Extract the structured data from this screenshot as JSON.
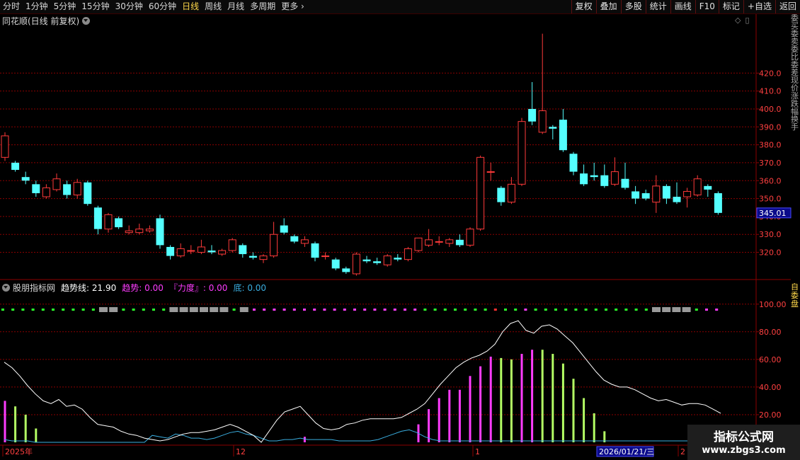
{
  "toolbar": {
    "periods": [
      "分时",
      "1分钟",
      "5分钟",
      "15分钟",
      "30分钟",
      "60分钟",
      "日线",
      "周线",
      "月线",
      "多周期",
      "更多"
    ],
    "active_period": "日线",
    "buttons": [
      "复权",
      "叠加",
      "多股",
      "统计",
      "画线",
      "F10",
      "标记",
      "+自选",
      "返回"
    ]
  },
  "main_panel": {
    "title": "同花顺(日线 前复权)",
    "price_label": "345.01",
    "y_ticks": [
      320,
      330,
      340,
      350,
      360,
      370,
      380,
      390,
      400,
      410,
      420
    ],
    "right_strip_text": "委买委卖委比委差现价涨跌幅换手"
  },
  "indicator_panel": {
    "name": "股朋指标网",
    "trend_line_label": "趋势线:",
    "trend_line_value": "21.90",
    "trend_label": "趋势:",
    "trend_value": "0.00",
    "force_label": "『力度』:",
    "force_value": "0.00",
    "bottom_label": "底:",
    "bottom_value": "0.00",
    "y_ticks": [
      "100.00",
      "80.00",
      "60.00",
      "40.00",
      "20.00"
    ],
    "right_strip_text": "自委盘"
  },
  "time_axis": {
    "labels": [
      "2025年",
      "12",
      "1",
      "2"
    ],
    "cursor_date": "2026/01/21/三"
  },
  "watermark": {
    "title": "指标公式网",
    "url": "www.zbgs3.com"
  },
  "colors": {
    "up": "#ff3a3a",
    "down": "#54ffff",
    "grid": "#8b0000",
    "trend_line": "#ffffff",
    "bottom_line": "#3aaee0",
    "bar_magenta": "#ff3cff",
    "bar_green": "#b4ff64"
  },
  "chart_data": {
    "type": "candlestick",
    "candles": [
      {
        "o": 373,
        "c": 385,
        "h": 387,
        "l": 371
      },
      {
        "o": 370,
        "c": 366,
        "h": 371,
        "l": 365
      },
      {
        "o": 362,
        "c": 360,
        "h": 365,
        "l": 358
      },
      {
        "o": 358,
        "c": 353,
        "h": 360,
        "l": 351
      },
      {
        "o": 351,
        "c": 356,
        "h": 358,
        "l": 350
      },
      {
        "o": 355,
        "c": 361,
        "h": 364,
        "l": 354
      },
      {
        "o": 358,
        "c": 352,
        "h": 360,
        "l": 350
      },
      {
        "o": 352,
        "c": 359,
        "h": 361,
        "l": 350
      },
      {
        "o": 359,
        "c": 347,
        "h": 360,
        "l": 346
      },
      {
        "o": 345,
        "c": 333,
        "h": 346,
        "l": 330
      },
      {
        "o": 333,
        "c": 341,
        "h": 342,
        "l": 331
      },
      {
        "o": 339,
        "c": 334,
        "h": 340,
        "l": 333
      },
      {
        "o": 331,
        "c": 332,
        "h": 335,
        "l": 330
      },
      {
        "o": 331,
        "c": 333,
        "h": 336,
        "l": 330
      },
      {
        "o": 332,
        "c": 333,
        "h": 335,
        "l": 331
      },
      {
        "o": 339,
        "c": 324,
        "h": 341,
        "l": 322
      },
      {
        "o": 323,
        "c": 318,
        "h": 324,
        "l": 316
      },
      {
        "o": 318,
        "c": 322,
        "h": 325,
        "l": 317
      },
      {
        "o": 321,
        "c": 321,
        "h": 324,
        "l": 319
      },
      {
        "o": 320,
        "c": 323,
        "h": 327,
        "l": 319
      },
      {
        "o": 321,
        "c": 320,
        "h": 324,
        "l": 319
      },
      {
        "o": 319,
        "c": 321,
        "h": 322,
        "l": 318
      },
      {
        "o": 321,
        "c": 327,
        "h": 328,
        "l": 320
      },
      {
        "o": 324,
        "c": 319,
        "h": 325,
        "l": 317
      },
      {
        "o": 318,
        "c": 317,
        "h": 320,
        "l": 316
      },
      {
        "o": 316,
        "c": 318,
        "h": 319,
        "l": 314
      },
      {
        "o": 318,
        "c": 330,
        "h": 337,
        "l": 317
      },
      {
        "o": 335,
        "c": 331,
        "h": 339,
        "l": 330
      },
      {
        "o": 329,
        "c": 326,
        "h": 330,
        "l": 325
      },
      {
        "o": 325,
        "c": 327,
        "h": 329,
        "l": 323
      },
      {
        "o": 325,
        "c": 317,
        "h": 326,
        "l": 315
      },
      {
        "o": 318,
        "c": 318,
        "h": 320,
        "l": 316
      },
      {
        "o": 316,
        "c": 311,
        "h": 317,
        "l": 310
      },
      {
        "o": 311,
        "c": 309,
        "h": 312,
        "l": 308
      },
      {
        "o": 308,
        "c": 319,
        "h": 320,
        "l": 307
      },
      {
        "o": 316,
        "c": 315,
        "h": 318,
        "l": 314
      },
      {
        "o": 315,
        "c": 314,
        "h": 317,
        "l": 313
      },
      {
        "o": 313,
        "c": 318,
        "h": 319,
        "l": 312
      },
      {
        "o": 317,
        "c": 316,
        "h": 319,
        "l": 315
      },
      {
        "o": 316,
        "c": 322,
        "h": 323,
        "l": 315
      },
      {
        "o": 321,
        "c": 328,
        "h": 328,
        "l": 320
      },
      {
        "o": 324,
        "c": 327,
        "h": 333,
        "l": 323
      },
      {
        "o": 326,
        "c": 326,
        "h": 329,
        "l": 324
      },
      {
        "o": 325,
        "c": 327,
        "h": 328,
        "l": 323
      },
      {
        "o": 327,
        "c": 324,
        "h": 330,
        "l": 323
      },
      {
        "o": 324,
        "c": 333,
        "h": 334,
        "l": 323
      },
      {
        "o": 333,
        "c": 373,
        "h": 374,
        "l": 332
      },
      {
        "o": 365,
        "c": 365,
        "h": 370,
        "l": 360
      },
      {
        "o": 356,
        "c": 348,
        "h": 357,
        "l": 346
      },
      {
        "o": 348,
        "c": 358,
        "h": 362,
        "l": 347
      },
      {
        "o": 358,
        "c": 393,
        "h": 395,
        "l": 357
      },
      {
        "o": 400,
        "c": 393,
        "h": 415,
        "l": 391
      },
      {
        "o": 387,
        "c": 399,
        "h": 442,
        "l": 386
      },
      {
        "o": 390,
        "c": 389,
        "h": 391,
        "l": 383
      },
      {
        "o": 394,
        "c": 377,
        "h": 400,
        "l": 376
      },
      {
        "o": 375,
        "c": 365,
        "h": 376,
        "l": 363
      },
      {
        "o": 364,
        "c": 358,
        "h": 369,
        "l": 357
      },
      {
        "o": 363,
        "c": 362,
        "h": 370,
        "l": 360
      },
      {
        "o": 363,
        "c": 357,
        "h": 369,
        "l": 356
      },
      {
        "o": 358,
        "c": 365,
        "h": 373,
        "l": 357
      },
      {
        "o": 361,
        "c": 356,
        "h": 370,
        "l": 355
      },
      {
        "o": 354,
        "c": 350,
        "h": 357,
        "l": 347
      },
      {
        "o": 353,
        "c": 350,
        "h": 355,
        "l": 349
      },
      {
        "o": 348,
        "c": 357,
        "h": 363,
        "l": 342
      },
      {
        "o": 357,
        "c": 350,
        "h": 358,
        "l": 347
      },
      {
        "o": 351,
        "c": 348,
        "h": 359,
        "l": 347
      },
      {
        "o": 351,
        "c": 354,
        "h": 356,
        "l": 345
      },
      {
        "o": 352,
        "c": 361,
        "h": 363,
        "l": 351
      },
      {
        "o": 357,
        "c": 355,
        "h": 358,
        "l": 351
      },
      {
        "o": 353,
        "c": 342,
        "h": 354,
        "l": 341
      }
    ],
    "ylim": [
      306,
      445
    ],
    "indicator": {
      "ylim": [
        0,
        105
      ],
      "trend_line": [
        58,
        54,
        48,
        41,
        35,
        30,
        28,
        31,
        26,
        27,
        24,
        18,
        13,
        12,
        11,
        8,
        6,
        5,
        3,
        2,
        1,
        2,
        4,
        6,
        7,
        7,
        8,
        9,
        11,
        13,
        11,
        8,
        5,
        0,
        8,
        16,
        22,
        24,
        26,
        20,
        14,
        10,
        9,
        10,
        13,
        14,
        16,
        17,
        17,
        17,
        17,
        18,
        21,
        24,
        28,
        35,
        42,
        48,
        54,
        58,
        61,
        63,
        66,
        71,
        80,
        86,
        88,
        81,
        79,
        84,
        85,
        82,
        77,
        72,
        65,
        58,
        51,
        45,
        42,
        40,
        40,
        38,
        35,
        32,
        30,
        31,
        29,
        27,
        28,
        28,
        27,
        24,
        21
      ],
      "bottom_line": [
        2,
        1,
        1,
        1,
        0,
        0,
        0,
        0,
        0,
        0,
        0,
        0,
        0,
        0,
        0,
        0,
        0,
        0,
        0,
        5,
        4,
        3,
        6,
        5,
        3,
        3,
        2,
        3,
        5,
        7,
        8,
        6,
        5,
        3,
        1,
        1,
        2,
        2,
        3,
        2,
        2,
        2,
        2,
        1,
        1,
        1,
        1,
        1,
        2,
        4,
        6,
        8,
        9,
        7,
        4,
        2,
        1,
        1,
        1,
        1,
        1,
        1,
        1,
        1,
        1,
        1,
        1,
        1,
        1,
        1,
        1,
        1,
        1,
        1,
        1,
        1,
        1,
        1,
        1,
        1,
        1,
        1,
        1,
        1,
        1,
        1,
        1,
        1,
        1,
        1,
        1,
        1,
        1
      ],
      "bars": [
        {
          "i": 0,
          "v": 30,
          "c": "magenta"
        },
        {
          "i": 1,
          "v": 26,
          "c": "green"
        },
        {
          "i": 2,
          "v": 20,
          "c": "green"
        },
        {
          "i": 3,
          "v": 10,
          "c": "green"
        },
        {
          "i": 29,
          "v": 4,
          "c": "magenta"
        },
        {
          "i": 40,
          "v": 13,
          "c": "magenta"
        },
        {
          "i": 41,
          "v": 24,
          "c": "magenta"
        },
        {
          "i": 42,
          "v": 32,
          "c": "magenta"
        },
        {
          "i": 43,
          "v": 38,
          "c": "magenta"
        },
        {
          "i": 44,
          "v": 38,
          "c": "magenta"
        },
        {
          "i": 45,
          "v": 48,
          "c": "magenta"
        },
        {
          "i": 46,
          "v": 55,
          "c": "magenta"
        },
        {
          "i": 47,
          "v": 62,
          "c": "magenta"
        },
        {
          "i": 48,
          "v": 61,
          "c": "green"
        },
        {
          "i": 49,
          "v": 60,
          "c": "green"
        },
        {
          "i": 50,
          "v": 64,
          "c": "magenta"
        },
        {
          "i": 51,
          "v": 67,
          "c": "magenta"
        },
        {
          "i": 52,
          "v": 67,
          "c": "green"
        },
        {
          "i": 53,
          "v": 64,
          "c": "green"
        },
        {
          "i": 54,
          "v": 57,
          "c": "green"
        },
        {
          "i": 55,
          "v": 46,
          "c": "green"
        },
        {
          "i": 56,
          "v": 32,
          "c": "green"
        },
        {
          "i": 57,
          "v": 21,
          "c": "green"
        },
        {
          "i": 58,
          "v": 8,
          "c": "green"
        }
      ],
      "signal_dots": "ggggggggggGGgggggGGGGGGgGmmmmmmmmmmmmmmmmmgggggggrggmggggggggggggGGGGgmm"
    }
  }
}
